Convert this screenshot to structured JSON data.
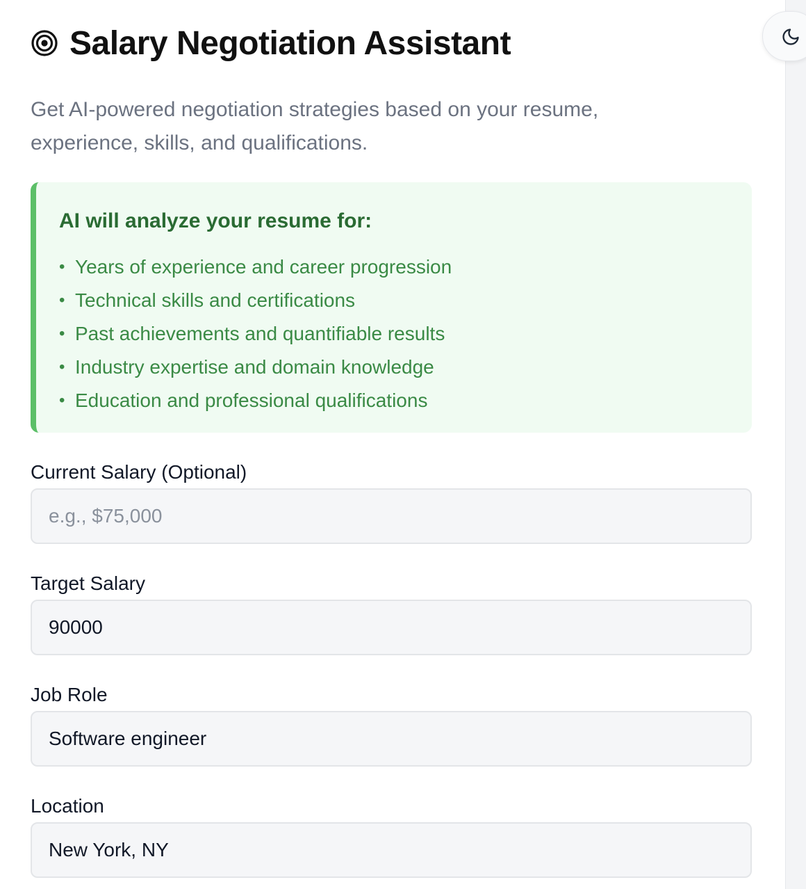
{
  "header": {
    "title": "Salary Negotiation Assistant",
    "title_icon": "target-icon",
    "subtitle": "Get AI-powered negotiation strategies based on your resume, experience, skills, and qualifications."
  },
  "theme_toggle": {
    "icon": "moon-icon"
  },
  "info_box": {
    "title": "AI will analyze your resume for:",
    "items": [
      "Years of experience and career progression",
      "Technical skills and certifications",
      "Past achievements and quantifiable results",
      "Industry expertise and domain knowledge",
      "Education and professional qualifications"
    ],
    "accent_color": "#5cbf68",
    "background_color": "#f0fbf2",
    "title_color": "#2a6b33",
    "item_color": "#3a8a45"
  },
  "form": {
    "current_salary": {
      "label": "Current Salary (Optional)",
      "value": "",
      "placeholder": "e.g., $75,000"
    },
    "target_salary": {
      "label": "Target Salary",
      "value": "90000",
      "placeholder": ""
    },
    "job_role": {
      "label": "Job Role",
      "value": "Software engineer",
      "placeholder": ""
    },
    "location": {
      "label": "Location",
      "value": "New York, NY",
      "placeholder": ""
    }
  }
}
